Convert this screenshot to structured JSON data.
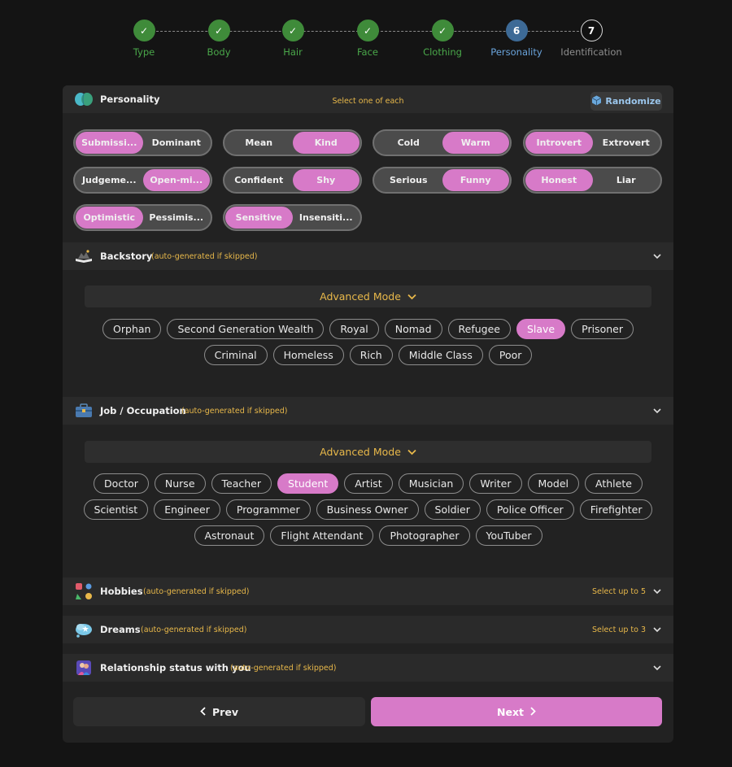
{
  "stepper": {
    "steps": [
      {
        "label": "Type",
        "state": "done",
        "mark": "✓"
      },
      {
        "label": "Body",
        "state": "done",
        "mark": "✓"
      },
      {
        "label": "Hair",
        "state": "done",
        "mark": "✓"
      },
      {
        "label": "Face",
        "state": "done",
        "mark": "✓"
      },
      {
        "label": "Clothing",
        "state": "done",
        "mark": "✓"
      },
      {
        "label": "Personality",
        "state": "active",
        "mark": "6"
      },
      {
        "label": "Identification",
        "state": "todo",
        "mark": "7"
      }
    ]
  },
  "personality": {
    "title": "Personality",
    "note": "Select one of each",
    "randomize_label": "Randomize",
    "traits": [
      {
        "left": "Submissi...",
        "right": "Dominant",
        "selected": "left"
      },
      {
        "left": "Mean",
        "right": "Kind",
        "selected": "right"
      },
      {
        "left": "Cold",
        "right": "Warm",
        "selected": "right"
      },
      {
        "left": "Introvert",
        "right": "Extrovert",
        "selected": "left"
      },
      {
        "left": "Judgeme...",
        "right": "Open-mi...",
        "selected": "right"
      },
      {
        "left": "Confident",
        "right": "Shy",
        "selected": "right"
      },
      {
        "left": "Serious",
        "right": "Funny",
        "selected": "right"
      },
      {
        "left": "Honest",
        "right": "Liar",
        "selected": "left"
      },
      {
        "left": "Optimistic",
        "right": "Pessimis...",
        "selected": "left"
      },
      {
        "left": "Sensitive",
        "right": "Insensiti...",
        "selected": "left"
      }
    ]
  },
  "backstory": {
    "title": "Backstory",
    "note": "(auto-generated if skipped)",
    "advanced_label": "Advanced Mode",
    "rows": [
      [
        "Orphan",
        "Second Generation Wealth",
        "Royal",
        "Nomad",
        "Refugee",
        "Slave",
        "Prisoner"
      ],
      [
        "Criminal",
        "Homeless",
        "Rich",
        "Middle Class",
        "Poor"
      ]
    ],
    "selected": "Slave"
  },
  "job": {
    "title": "Job / Occupation",
    "note": "(auto-generated if skipped)",
    "advanced_label": "Advanced Mode",
    "rows": [
      [
        "Doctor",
        "Nurse",
        "Teacher",
        "Student",
        "Artist",
        "Musician",
        "Writer",
        "Model",
        "Athlete"
      ],
      [
        "Scientist",
        "Engineer",
        "Programmer",
        "Business Owner",
        "Soldier",
        "Police Officer",
        "Firefighter"
      ],
      [
        "Astronaut",
        "Flight Attendant",
        "Photographer",
        "YouTuber"
      ]
    ],
    "selected": "Student"
  },
  "hobbies": {
    "title": "Hobbies",
    "note": "(auto-generated if skipped)",
    "right": "Select up to 5"
  },
  "dreams": {
    "title": "Dreams",
    "note": "(auto-generated if skipped)",
    "right": "Select up to 3"
  },
  "relationship": {
    "title": "Relationship status with you",
    "note": "(auto-generated if skipped)"
  },
  "nav": {
    "prev_label": "Prev",
    "next_label": "Next"
  },
  "colors": {
    "accent": "#d77ac8",
    "done": "#3f8b3a",
    "active": "#3d6a96",
    "note": "#e8b84a"
  }
}
